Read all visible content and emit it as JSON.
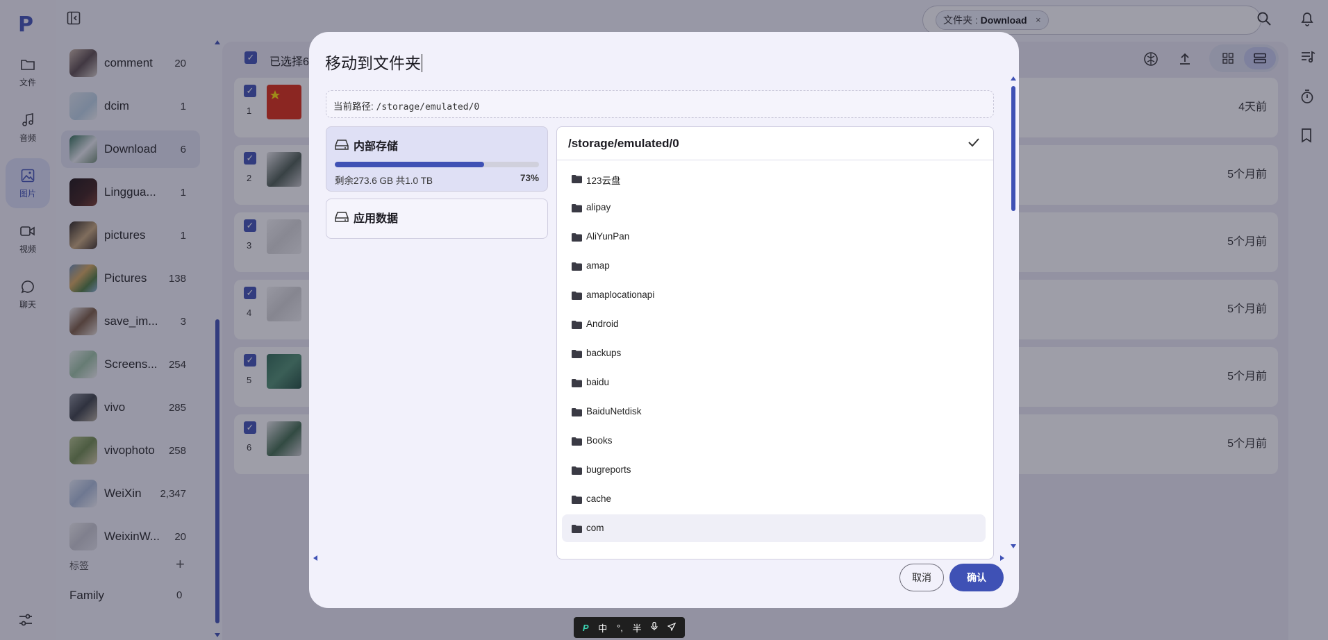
{
  "app": {
    "logo": "P",
    "rail": [
      {
        "label": "文件",
        "icon": "folder-icon"
      },
      {
        "label": "音频",
        "icon": "music-icon"
      },
      {
        "label": "图片",
        "icon": "image-icon",
        "active": true
      },
      {
        "label": "视频",
        "icon": "video-icon"
      },
      {
        "label": "聊天",
        "icon": "chat-icon"
      }
    ]
  },
  "sidebar": {
    "folders": [
      {
        "name": "comment",
        "count": "20"
      },
      {
        "name": "dcim",
        "count": "1"
      },
      {
        "name": "Download",
        "count": "6",
        "active": true
      },
      {
        "name": "Linggua...",
        "count": "1"
      },
      {
        "name": "pictures",
        "count": "1"
      },
      {
        "name": "Pictures",
        "count": "138"
      },
      {
        "name": "save_im...",
        "count": "3"
      },
      {
        "name": "Screens...",
        "count": "254"
      },
      {
        "name": "vivo",
        "count": "285"
      },
      {
        "name": "vivophoto",
        "count": "258"
      },
      {
        "name": "WeiXin",
        "count": "2,347"
      },
      {
        "name": "WeixinW...",
        "count": "20"
      }
    ],
    "tags_label": "标签",
    "add_symbol": "+",
    "tags": [
      {
        "name": "Family",
        "count": "0"
      }
    ]
  },
  "header": {
    "search_chip_prefix": "文件夹 : ",
    "search_chip_value": "Download",
    "search_chip_close": "×"
  },
  "main": {
    "selected_text": "已选择6",
    "rows": [
      {
        "index": "1",
        "time": "4天前"
      },
      {
        "index": "2",
        "time": "5个月前"
      },
      {
        "index": "3",
        "time": "5个月前"
      },
      {
        "index": "4",
        "time": "5个月前"
      },
      {
        "index": "5",
        "time": "5个月前"
      },
      {
        "index": "6",
        "time": "5个月前"
      }
    ]
  },
  "dialog": {
    "title": "移动到文件夹",
    "current_path_label": "当前路径: ",
    "current_path": "/storage/emulated/0",
    "volumes": [
      {
        "name": "内部存储",
        "info": "剩余273.6 GB 共1.0 TB",
        "percent_label": "73%",
        "used_fraction": 0.73
      },
      {
        "name": "应用数据"
      }
    ],
    "panel_path": "/storage/emulated/0",
    "folders": [
      "123云盘",
      "alipay",
      "AliYunPan",
      "amap",
      "amaplocationapi",
      "Android",
      "backups",
      "baidu",
      "BaiduNetdisk",
      "Books",
      "bugreports",
      "cache",
      "com"
    ],
    "cancel_label": "取消",
    "confirm_label": "确认"
  },
  "ime": {
    "brand": "P",
    "lang": "中",
    "punct": "°,",
    "width": "半"
  },
  "colors": {
    "accent": "#3f51b5",
    "dialog_bg": "#f2f1fb",
    "selected_volume_bg": "#dfe0f5"
  }
}
